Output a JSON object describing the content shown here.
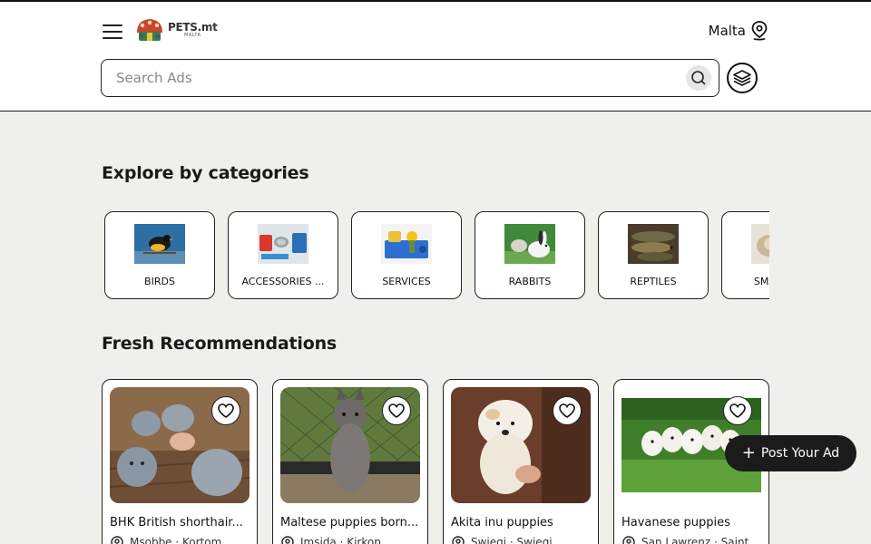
{
  "header": {
    "logo_text": "PETS.mt",
    "logo_sub": "MALTA",
    "location": "Malta"
  },
  "search": {
    "placeholder": "Search Ads"
  },
  "categories_section": {
    "title": "Explore by categories",
    "items": [
      {
        "label": "BIRDS",
        "icon": "bird-photo"
      },
      {
        "label": "ACCESSORIES ...",
        "icon": "accessories-photo"
      },
      {
        "label": "SERVICES",
        "icon": "services-photo"
      },
      {
        "label": "RABBITS",
        "icon": "rabbit-photo"
      },
      {
        "label": "REPTILES",
        "icon": "reptile-photo"
      },
      {
        "label": "SMALL ...",
        "icon": "small-animal-photo"
      }
    ]
  },
  "recommendations_section": {
    "title": "Fresh Recommendations",
    "items": [
      {
        "title": "BHK British shorthair...",
        "location": "Msobbe · Kortom..."
      },
      {
        "title": "Maltese puppies born...",
        "location": "Imsida · Kirkop..."
      },
      {
        "title": "Akita inu puppies",
        "location": "Swieqi · Swieqi..."
      },
      {
        "title": "Havanese puppies",
        "location": "San Lawrenz · Saint..."
      }
    ]
  },
  "post_ad": {
    "label": "Post Your Ad"
  },
  "colors": {
    "page_bg": "#efefeb",
    "dark": "#1b1b1b",
    "white": "#ffffff"
  }
}
